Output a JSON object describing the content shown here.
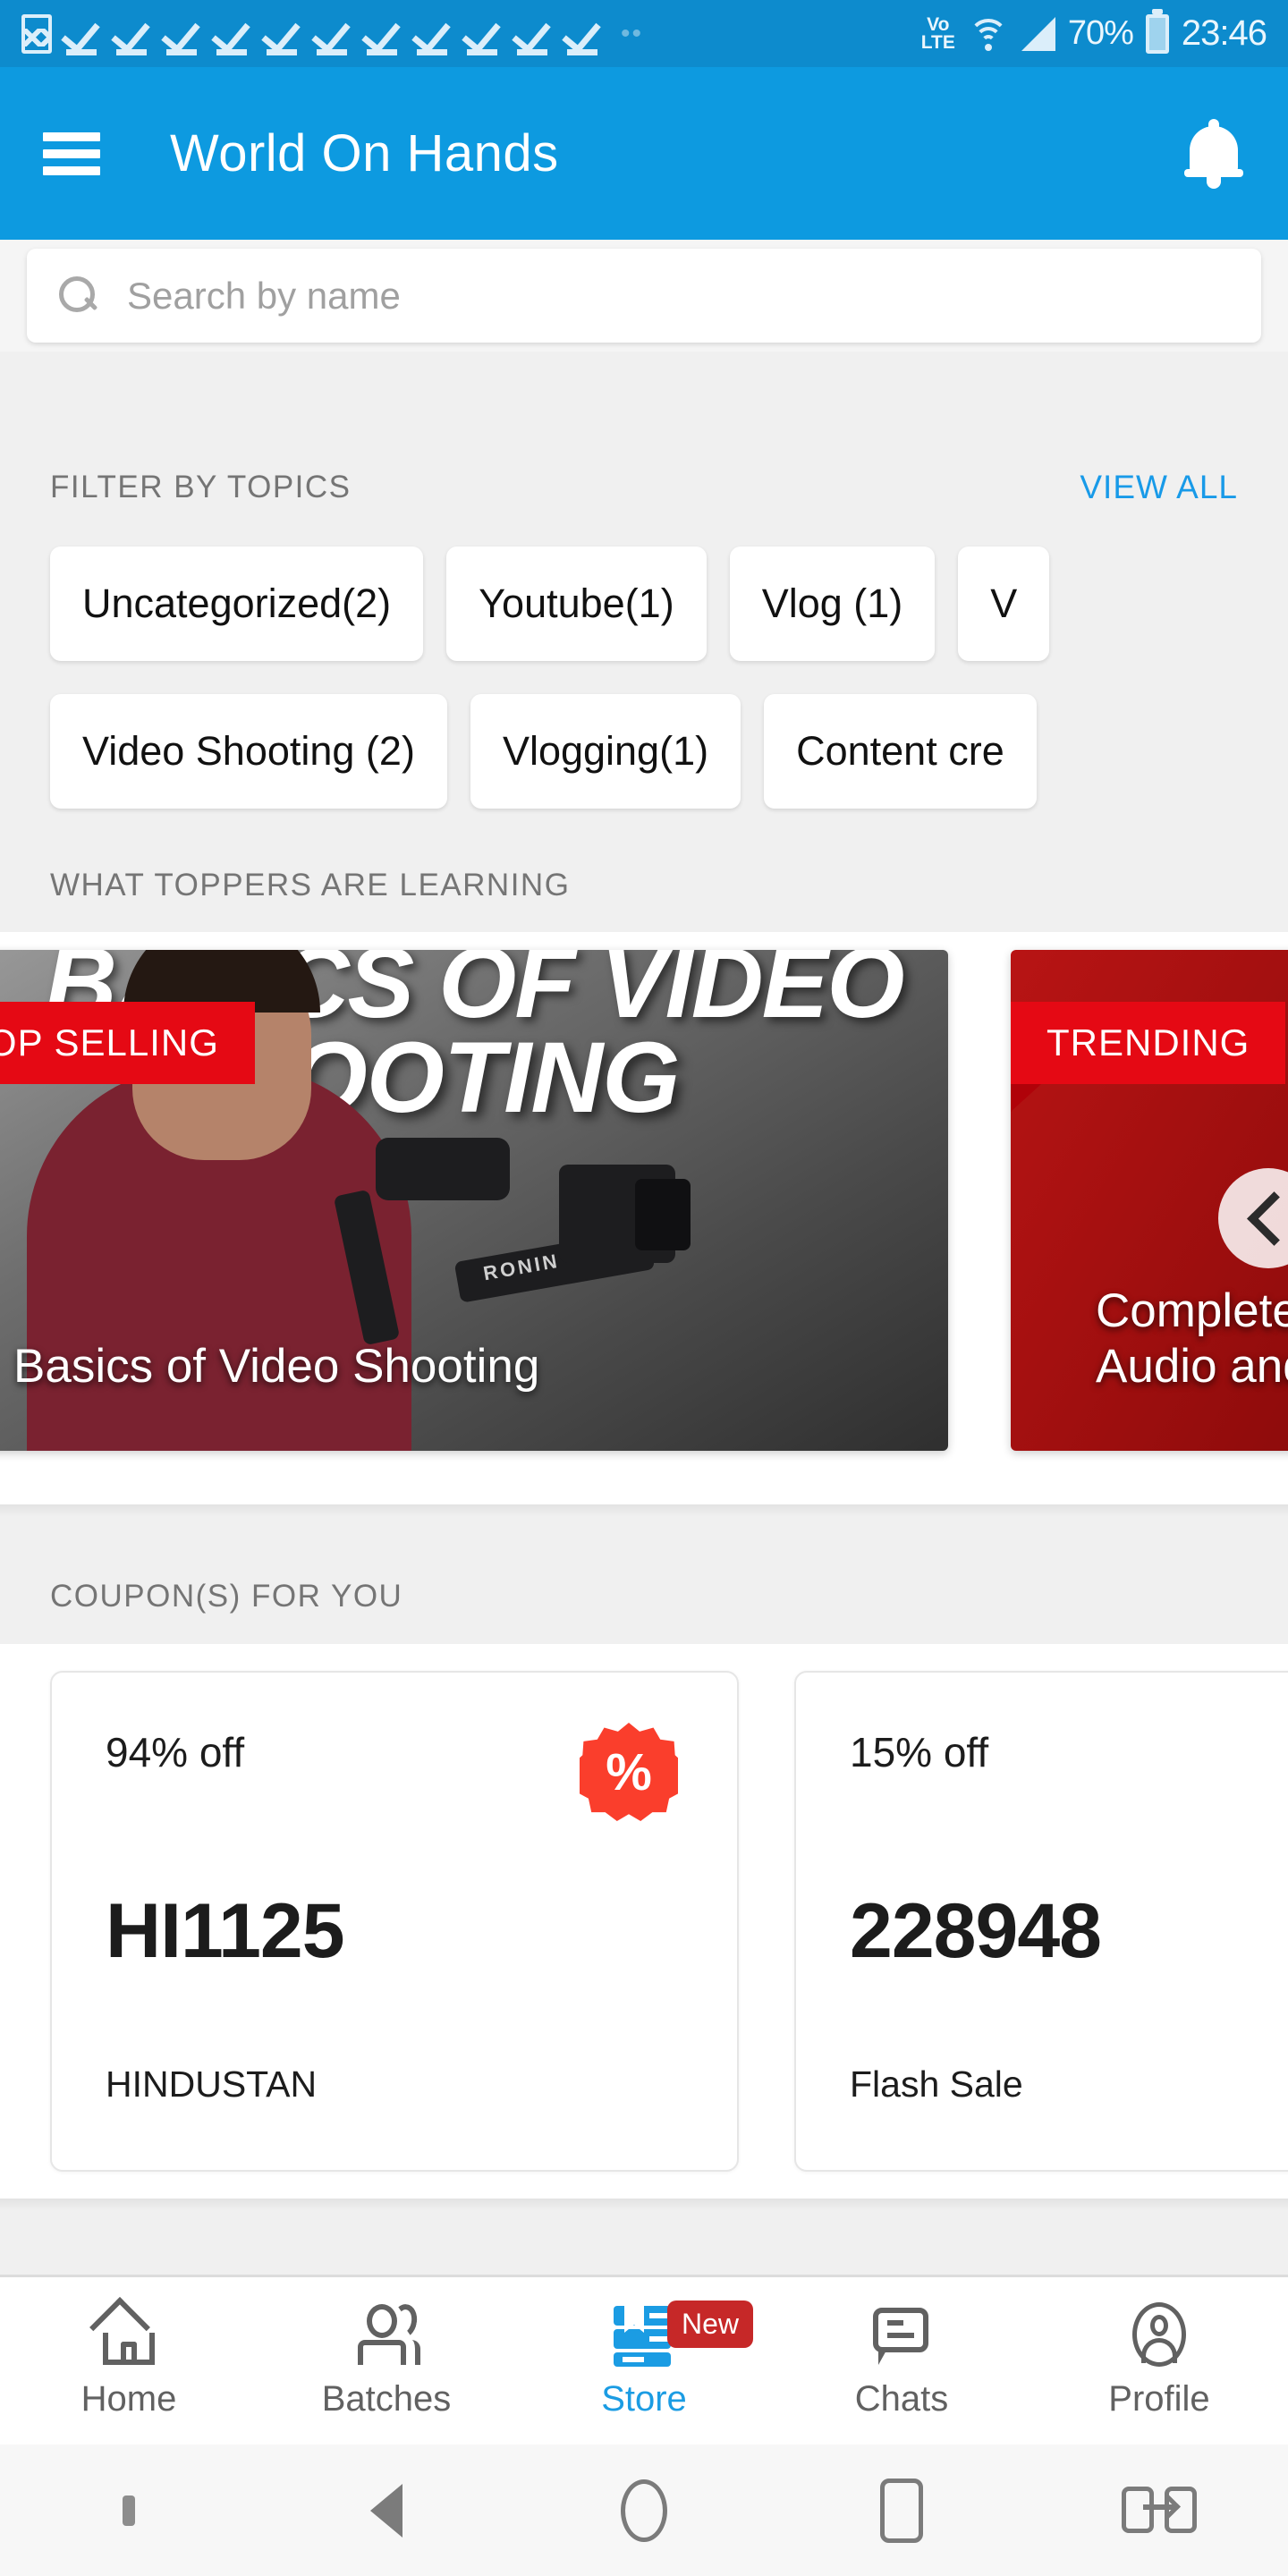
{
  "status_bar": {
    "notification_icons": [
      "image-icon",
      "check-icon",
      "check-icon",
      "check-icon",
      "check-icon",
      "check-icon",
      "check-icon",
      "check-icon",
      "check-icon",
      "check-icon",
      "check-icon",
      "check-icon"
    ],
    "overflow_dots": "••",
    "volte_top": "Vo",
    "volte_bottom": "LTE",
    "wifi": "wifi-icon",
    "signal": "signal-icon",
    "battery_percent": "70%",
    "time": "23:46"
  },
  "app_bar": {
    "menu_icon": "hamburger-menu-icon",
    "title": "World On Hands",
    "notification_icon": "bell-icon",
    "background_color": "#0d9ae0"
  },
  "search": {
    "icon": "search-icon",
    "placeholder": "Search by name",
    "value": ""
  },
  "filter_section": {
    "label": "FILTER BY TOPICS",
    "view_all": "VIEW ALL",
    "accent_color": "#189ae8",
    "chips_row1": [
      {
        "label": "Uncategorized(2)"
      },
      {
        "label": "Youtube(1)"
      },
      {
        "label": "Vlog (1)"
      },
      {
        "label": "V"
      }
    ],
    "chips_row2": [
      {
        "label": "Video Shooting (2)"
      },
      {
        "label": "Vlogging(1)"
      },
      {
        "label": "Content cre"
      }
    ]
  },
  "toppers_section": {
    "label": "WHAT TOPPERS ARE LEARNING",
    "cards": [
      {
        "badge": "TOP SELLING",
        "badge_color": "#e50914",
        "thumb_text_line1": "BASICS OF VIDEO",
        "thumb_text_line2": "SHOOTING",
        "title": "Basics of Video Shooting",
        "brand_label": "RONIN"
      },
      {
        "badge": "TRENDING",
        "badge_color": "#e50914",
        "title_line1": "Complete",
        "title_line2": "Audio and"
      }
    ],
    "prev_arrow_icon": "chevron-left-icon"
  },
  "coupon_section": {
    "label": "COUPON(S) FOR YOU",
    "coupons": [
      {
        "discount": "94% off",
        "code": "HI1125",
        "name": "HINDUSTAN",
        "badge_icon": "percent-badge-icon",
        "badge_glyph": "%",
        "badge_color": "#fa3e2c"
      },
      {
        "discount": "15% off",
        "code": "228948",
        "name": "Flash Sale"
      }
    ]
  },
  "bottom_nav": {
    "active_color": "#1b9ce3",
    "inactive_color": "#616161",
    "items": [
      {
        "label": "Home",
        "icon": "home-icon",
        "active": false,
        "badge": ""
      },
      {
        "label": "Batches",
        "icon": "people-icon",
        "active": false,
        "badge": ""
      },
      {
        "label": "Store",
        "icon": "books-icon",
        "active": true,
        "badge": "New"
      },
      {
        "label": "Chats",
        "icon": "chat-bubble-icon",
        "active": false,
        "badge": ""
      },
      {
        "label": "Profile",
        "icon": "person-icon",
        "active": false,
        "badge": ""
      }
    ]
  },
  "system_nav": {
    "items": [
      "dot-icon",
      "back-triangle-icon",
      "home-circle-icon",
      "recents-square-icon",
      "app-switch-icon"
    ]
  }
}
